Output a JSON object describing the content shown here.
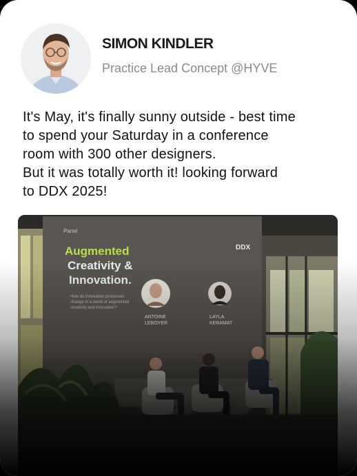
{
  "author": {
    "name": "SIMON KINDLER",
    "role": "Practice Lead Concept @HYVE"
  },
  "post": {
    "lines": [
      "It's May, it's finally sunny outside - best time",
      "to spend your Saturday in a conference",
      "room with 300 other designers.",
      "But it was totally worth it! looking forward",
      "to DDX 2025!"
    ]
  },
  "photo": {
    "slide": {
      "tag": "Panel",
      "title_line1": "Augmented",
      "title_line2": "Creativity &",
      "title_line3": "Innovation.",
      "question_line1": "How do innovation processes",
      "question_line2": "change in a world of augmented",
      "question_line3": "creativity and innovation?",
      "logo": "DDX",
      "speaker1_first": "ANTOINE",
      "speaker1_last": "LEBOYER",
      "speaker2_first": "LAYLA",
      "speaker2_last": "KERAMAT"
    }
  },
  "colors": {
    "accent_green": "#b8e04a",
    "slide_bg": "#595550"
  }
}
